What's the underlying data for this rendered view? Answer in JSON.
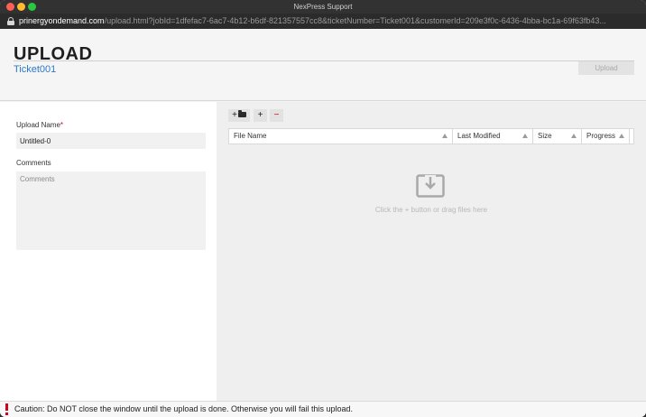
{
  "window": {
    "title": "NexPress Support",
    "url_host": "prinergyondemand.com",
    "url_rest": "/upload.html?jobId=1dfefac7-6ac7-4b12-b6df-821357557cc8&ticketNumber=Ticket001&customerId=209e3f0c-6436-4bba-bc1a-69f63fb43..."
  },
  "header": {
    "title": "UPLOAD",
    "ticket": "Ticket001",
    "upload_button": "Upload"
  },
  "form": {
    "upload_name_label": "Upload Name",
    "required_mark": "*",
    "upload_name_value": "Untitled-0",
    "comments_label": "Comments",
    "comments_placeholder": "Comments"
  },
  "toolbar": {
    "add_folder_label": "+",
    "add_label": "+",
    "remove_label": "−"
  },
  "table": {
    "columns": [
      "File Name",
      "Last Modified",
      "Size",
      "Progress"
    ],
    "empty_hint": "Click the + button or drag files here"
  },
  "footer": {
    "caution": "Caution: Do NOT close the window until the upload is done. Otherwise you will fail this upload."
  },
  "colors": {
    "accent_link": "#2e79c6",
    "danger": "#d0021b"
  },
  "icons": [
    "lock-icon",
    "add-folder-icon",
    "plus-icon",
    "minus-icon",
    "sort-arrow-icon",
    "download-tray-icon",
    "warning-icon"
  ]
}
